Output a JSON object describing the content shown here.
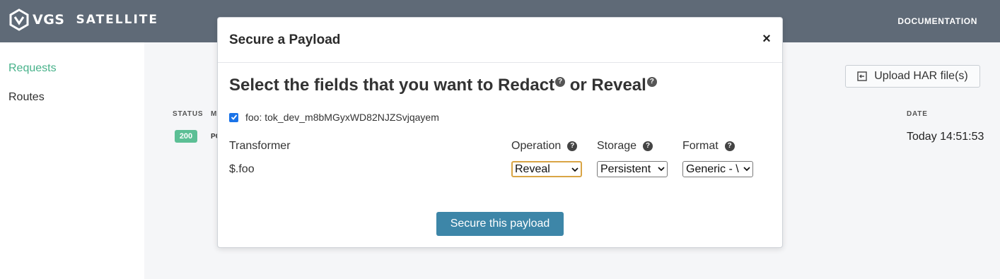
{
  "header": {
    "brand_vgs": "VGS",
    "brand_satellite": "SATELLITE",
    "documentation": "DOCUMENTATION"
  },
  "sidebar": {
    "items": [
      {
        "label": "Requests",
        "active": true
      },
      {
        "label": "Routes",
        "active": false
      }
    ]
  },
  "main": {
    "upload_label": "Upload HAR file(s)",
    "columns": {
      "status": "STATUS",
      "method": "M",
      "date": "DATE"
    },
    "row": {
      "status": "200",
      "method": "PO",
      "date": "Today 14:51:53"
    }
  },
  "modal": {
    "title": "Secure a Payload",
    "close": "×",
    "heading_prefix": "Select the fields that you want to Redact",
    "heading_or": " or Reveal",
    "help_glyph": "?",
    "field_label": "foo: tok_dev_m8bMGyxWD82NJZSvjqayem",
    "field_checked": true,
    "table": {
      "transformer": "Transformer",
      "operation": "Operation",
      "storage": "Storage",
      "format": "Format"
    },
    "row": {
      "path": "$.foo",
      "operation": "Reveal",
      "storage": "Persistent",
      "format": "Generic - \\"
    },
    "submit": "Secure this payload"
  },
  "colors": {
    "topbar": "#5f6a77",
    "accent_green": "#47b28a",
    "badge_green": "#5cbf95",
    "primary_button": "#3d86a8",
    "focus_outline": "#d9a545"
  }
}
